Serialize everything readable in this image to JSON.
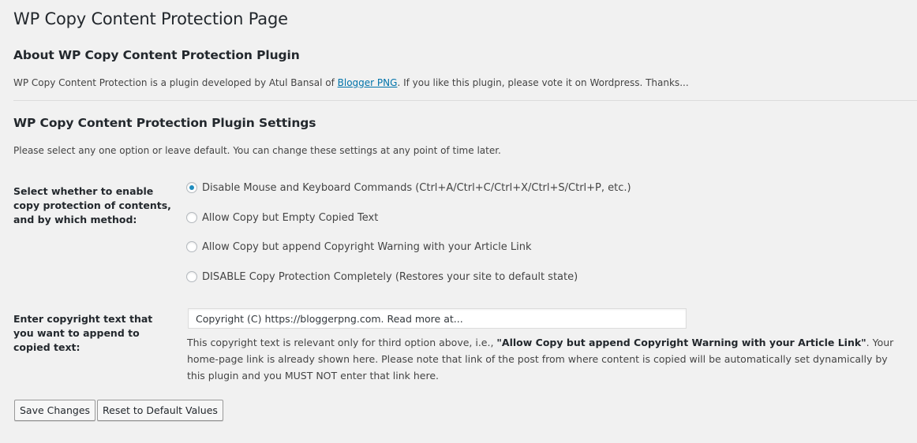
{
  "page": {
    "title": "WP Copy Content Protection Page"
  },
  "about": {
    "heading": "About WP Copy Content Protection Plugin",
    "text_before_link": "WP Copy Content Protection is a plugin developed by Atul Bansal of ",
    "link_text": "Blogger PNG",
    "text_after_link": ". If you like this plugin, please vote it on Wordpress. Thanks..."
  },
  "settings": {
    "heading": "WP Copy Content Protection Plugin Settings",
    "intro": "Please select any one option or leave default. You can change these settings at any point of time later.",
    "protection_method": {
      "label": "Select whether to enable copy protection of contents, and by which method:",
      "options": [
        {
          "label": "Disable Mouse and Keyboard Commands (Ctrl+A/Ctrl+C/Ctrl+X/Ctrl+S/Ctrl+P, etc.)",
          "selected": true
        },
        {
          "label": "Allow Copy but Empty Copied Text",
          "selected": false
        },
        {
          "label": "Allow Copy but append Copyright Warning with your Article Link",
          "selected": false
        },
        {
          "label": "DISABLE Copy Protection Completely (Restores your site to default state)",
          "selected": false
        }
      ]
    },
    "copyright_text": {
      "label": "Enter copyright text that you want to append to copied text:",
      "value": "Copyright (C) https://bloggerpng.com. Read more at...",
      "help_before": "This copyright text is relevant only for third option above, i.e., ",
      "help_bold": "\"Allow Copy but append Copyright Warning with your Article Link\"",
      "help_after": ". Your home-page link is already shown here. Please note that link of the post from where content is copied will be automatically set dynamically by this plugin and you MUST NOT enter that link here."
    }
  },
  "buttons": {
    "save": "Save Changes",
    "reset": "Reset to Default Values"
  },
  "colors": {
    "background": "#f1f1f1",
    "link": "#0073aa",
    "radio_checked": "#1e8cbe"
  }
}
